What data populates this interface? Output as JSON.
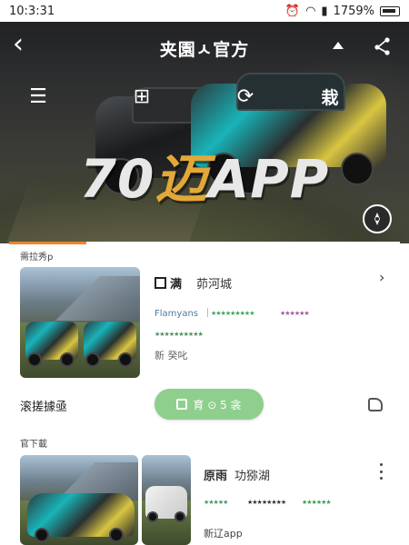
{
  "status": {
    "time": "10:3:31",
    "battery": "1759%"
  },
  "topbar": {
    "back_glyph": "‹",
    "title": "夹園ㅅ官方"
  },
  "iconrow": {
    "menu_glyph": "☰",
    "add_glyph": "⊞",
    "rotate_glyph": "⟳",
    "right_label": "栽"
  },
  "brand": {
    "left": "70",
    "mid": "迈",
    "right": "APP"
  },
  "colors": {
    "accent": "#f0832a",
    "brand_mid": "#e2a838",
    "button_bg": "#8fcf8e",
    "link": "#4a7c9f"
  },
  "section1": {
    "label": "需拉秀p",
    "title_prefix": "满",
    "title_suffix": "茆河城",
    "tagline": "Flamyans",
    "note": "新 癸叱",
    "left_label": "滚搓據亟",
    "download_label": "育 ⊙ 5 衾",
    "stars": [
      {
        "filled": "★★★★★★★★★",
        "color": "#3aa65a"
      },
      {
        "filled": "★★★★★★",
        "color": "#a05a9b"
      },
      {
        "filled": "★★★★★★★★★★",
        "color": "#4f8f5a"
      }
    ]
  },
  "section2": {
    "label": "官下載",
    "title_main": "原雨",
    "title_sub": "功猕湖",
    "note": "新辽app",
    "stars": [
      {
        "filled": "★★★★★",
        "color": "#3c9f55"
      },
      {
        "filled": "★★★★★★★★",
        "color": "#333333"
      },
      {
        "filled": "★★★★★★",
        "color": "#3c9f55"
      }
    ]
  }
}
